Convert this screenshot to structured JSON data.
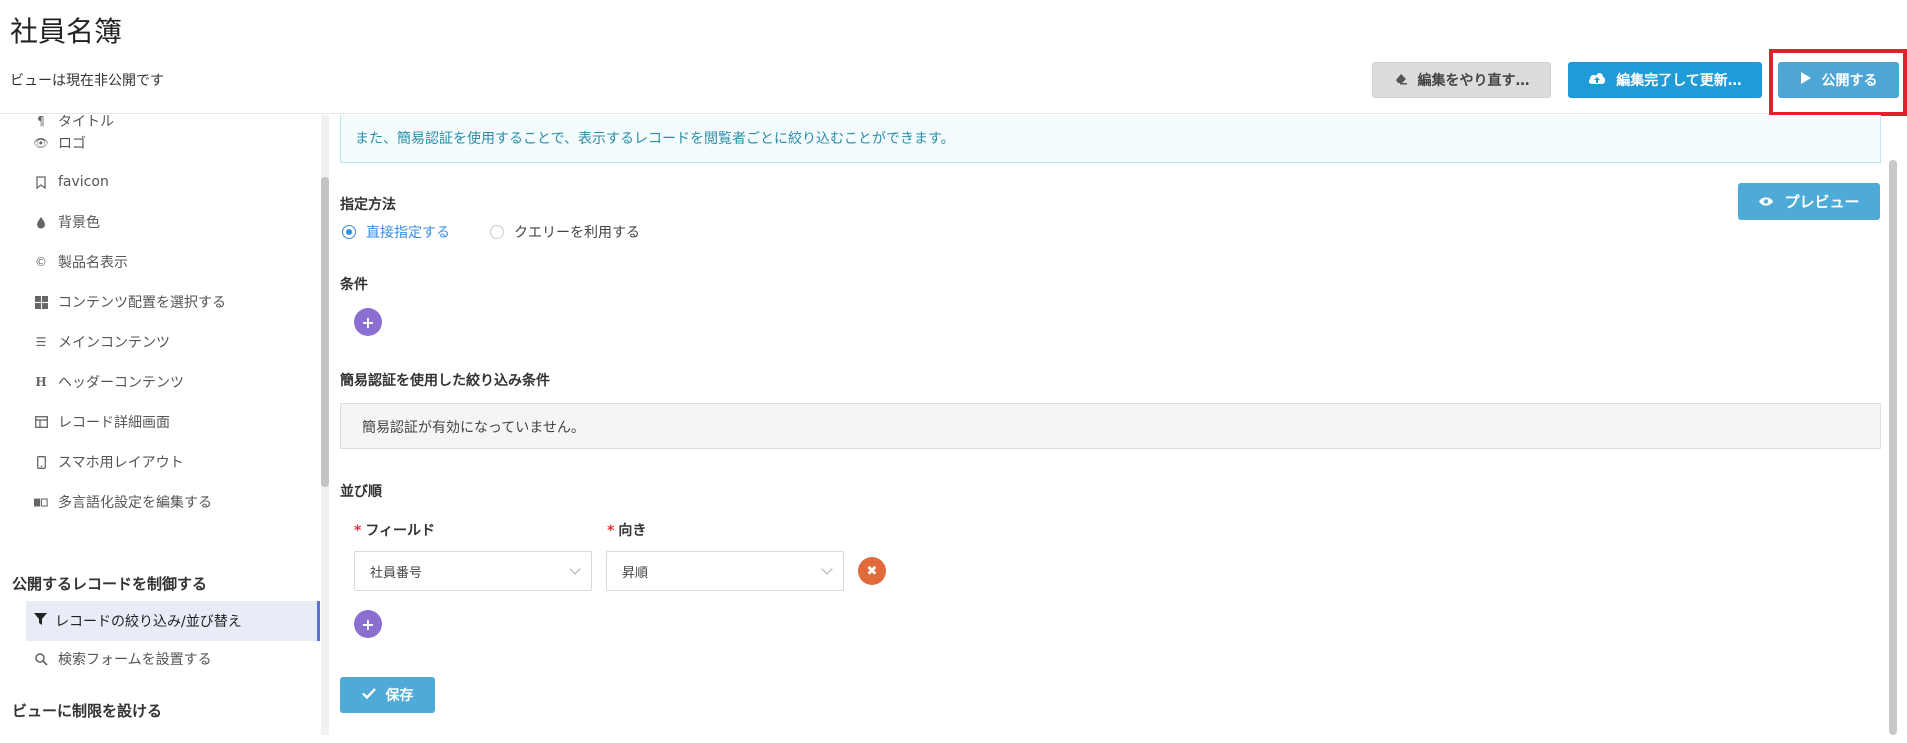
{
  "header": {
    "title": "社員名簿",
    "status": "ビューは現在非公開です",
    "redo_label": "編集をやり直す…",
    "update_label": "編集完了して更新…",
    "publish_label": "公開する"
  },
  "sidebar": {
    "items": [
      {
        "label": "タイトル",
        "icon": "paragraph-icon"
      },
      {
        "label": "ロゴ",
        "icon": "eye-icon"
      },
      {
        "label": "favicon",
        "icon": "bookmark-icon"
      },
      {
        "label": "背景色",
        "icon": "drop-icon"
      },
      {
        "label": "製品名表示",
        "icon": "copyright-icon"
      },
      {
        "label": "コンテンツ配置を選択する",
        "icon": "grid-icon"
      },
      {
        "label": "メインコンテンツ",
        "icon": "list-icon"
      },
      {
        "label": "ヘッダーコンテンツ",
        "icon": "heading-icon"
      },
      {
        "label": "レコード詳細画面",
        "icon": "layout-icon"
      },
      {
        "label": "スマホ用レイアウト",
        "icon": "mobile-icon"
      },
      {
        "label": "多言語化設定を編集する",
        "icon": "language-icon"
      }
    ],
    "section_publish": "公開するレコードを制御する",
    "active_item": "レコードの絞り込み/並び替え",
    "search_form_item": "検索フォームを設置する",
    "section_restrict": "ビューに制限を設ける"
  },
  "main": {
    "info_text": "また、簡易認証を使用することで、表示するレコードを閲覧者ごとに絞り込むことができます。",
    "method_label": "指定方法",
    "radio_direct": "直接指定する",
    "radio_query": "クエリーを利用する",
    "preview_label": "プレビュー",
    "condition_label": "条件",
    "auth_filter_label": "簡易認証を使用した絞り込み条件",
    "auth_disabled_text": "簡易認証が有効になっていません。",
    "sort_label": "並び順",
    "field_label": "フィールド",
    "direction_label": "向き",
    "field_value": "社員番号",
    "direction_value": "昇順",
    "save_label": "保存"
  }
}
